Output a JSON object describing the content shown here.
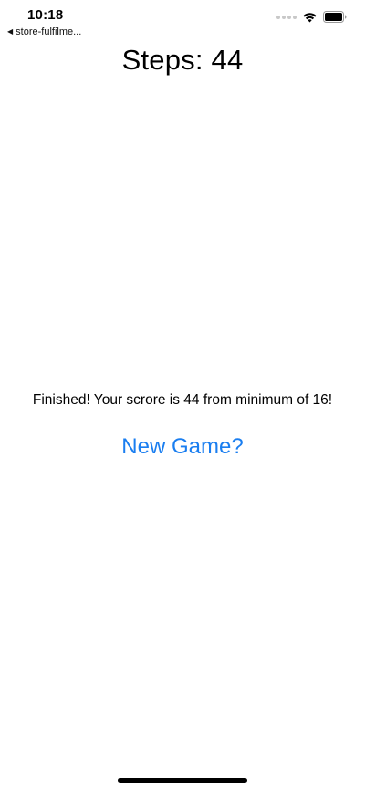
{
  "status_bar": {
    "time": "10:18",
    "back_label": "store-fulfilme...",
    "back_icon": "back-triangle-icon",
    "wifi_icon": "wifi-icon",
    "battery_icon": "battery-icon"
  },
  "game": {
    "steps_label": "Steps: 44",
    "finish_message": "Finished! Your scrore is 44 from minimum of 16!",
    "new_game_label": "New Game?"
  },
  "colors": {
    "accent": "#1a7ef0",
    "text": "#000000",
    "background": "#ffffff"
  }
}
